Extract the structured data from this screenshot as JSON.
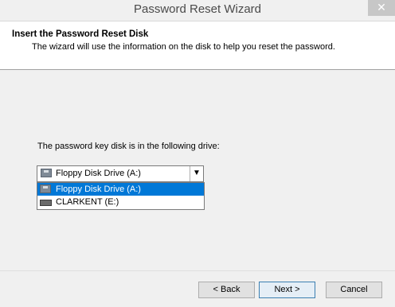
{
  "window": {
    "title": "Password Reset Wizard",
    "close_label": "✕"
  },
  "header": {
    "title": "Insert the Password Reset Disk",
    "subtitle": "The wizard will use the information on the disk to help you reset the password."
  },
  "body": {
    "drive_label": "The password key disk is in the following drive:",
    "drive_select": {
      "selected_value": "Floppy Disk Drive (A:)",
      "arrow_icon": "chevron-down-icon",
      "options": [
        {
          "label": "Floppy Disk Drive (A:)",
          "icon": "floppy-drive-icon",
          "highlighted": true
        },
        {
          "label": "CLARKENT (E:)",
          "icon": "usb-drive-icon",
          "highlighted": false
        }
      ]
    }
  },
  "footer": {
    "back_label": "< Back",
    "next_label": "Next >",
    "cancel_label": "Cancel"
  },
  "colors": {
    "highlight": "#0078d7",
    "header_bg": "#ffffff",
    "window_bg": "#f0f0f0"
  }
}
